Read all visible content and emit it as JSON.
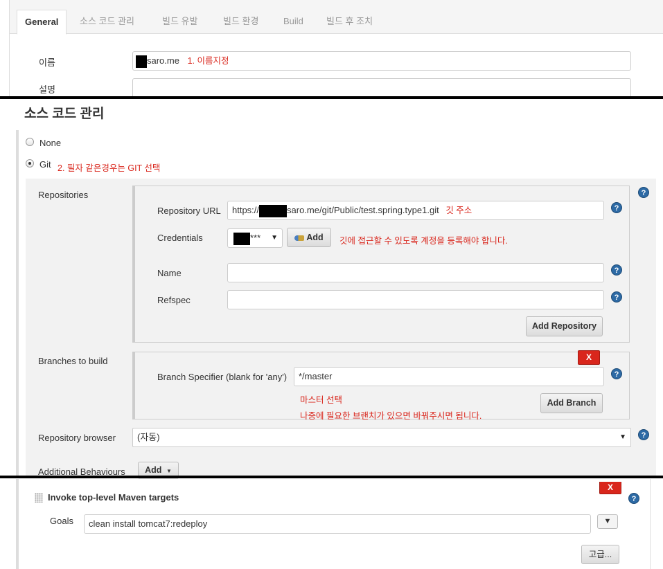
{
  "tabs": [
    {
      "label": "General",
      "active": true
    },
    {
      "label": "소스 코드 관리",
      "active": false
    },
    {
      "label": "빌드 유발",
      "active": false
    },
    {
      "label": "빌드 환경",
      "active": false
    },
    {
      "label": "Build",
      "active": false
    },
    {
      "label": "빌드 후 조치",
      "active": false
    }
  ],
  "general": {
    "name_label": "이름",
    "name_value": "saro.me",
    "name_note": "1. 이름지정",
    "desc_label": "설명"
  },
  "scm": {
    "title": "소스 코드 관리",
    "none_label": "None",
    "git_label": "Git",
    "git_note": "2. 필자 같은경우는 GIT 선택",
    "selected": "Git",
    "repositories_label": "Repositories",
    "repo_url_label": "Repository URL",
    "repo_url_prefix": "https://",
    "repo_url_suffix": "saro.me/git/Public/test.spring.type1.git",
    "repo_url_note": "깃 주소",
    "credentials_label": "Credentials",
    "credentials_value": "***",
    "add_button": "Add",
    "credentials_note": "깃에 접근할 수 있도록 계정을 등록해야 합니다.",
    "name_label": "Name",
    "name_value": "",
    "refspec_label": "Refspec",
    "refspec_value": "",
    "add_repository_button": "Add Repository",
    "branches_label": "Branches to build",
    "delete_button": "X",
    "branch_spec_label": "Branch Specifier (blank for 'any')",
    "branch_spec_value": "*/master",
    "branch_note_1": "마스터 선택",
    "branch_note_2": "나중에 필요한 브랜치가 있으면 바꿔주시면 됩니다.",
    "add_branch_button": "Add Branch",
    "repo_browser_label": "Repository browser",
    "repo_browser_value": "(자동)",
    "additional_label": "Additional Behaviours",
    "additional_add_button": "Add"
  },
  "maven": {
    "title": "Invoke top-level Maven targets",
    "delete_button": "X",
    "goals_label": "Goals",
    "goals_value": "clean install tomcat7:redeploy",
    "advanced_button": "고급..."
  },
  "help_glyph": "?",
  "icons": [
    "help-icon",
    "key-icon",
    "dropdown-arrow-icon",
    "drag-handle-icon",
    "expand-icon"
  ]
}
